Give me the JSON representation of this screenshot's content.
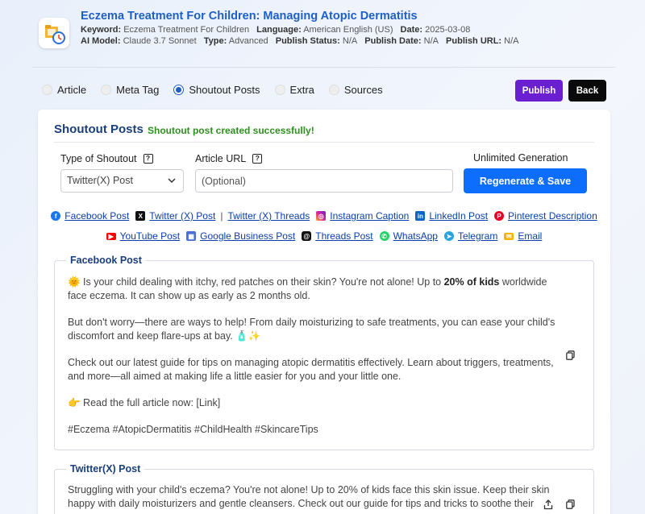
{
  "header": {
    "title": "Eczema Treatment For Children: Managing Atopic Dermatitis",
    "keyword_label": "Keyword:",
    "keyword": "Eczema Treatment For Children",
    "language_label": "Language:",
    "language": "American English (US)",
    "date_label": "Date:",
    "date": "2025-03-08",
    "model_label": "AI Model:",
    "model": "Claude 3.7 Sonnet",
    "type_label": "Type:",
    "type": "Advanced",
    "publish_status_label": "Publish Status:",
    "publish_status": "N/A",
    "publish_date_label": "Publish Date:",
    "publish_date": "N/A",
    "publish_url_label": "Publish URL:",
    "publish_url": "N/A"
  },
  "tabs": [
    {
      "label": "Article",
      "selected": false
    },
    {
      "label": "Meta Tag",
      "selected": false
    },
    {
      "label": "Shoutout Posts",
      "selected": true
    },
    {
      "label": "Extra",
      "selected": false
    },
    {
      "label": "Sources",
      "selected": false
    }
  ],
  "actions": {
    "publish": "Publish",
    "back": "Back"
  },
  "card": {
    "title": "Shoutout Posts",
    "success": "Shoutout post created successfully!",
    "type_label": "Type of Shoutout",
    "type_value": "Twitter(X) Post",
    "url_label": "Article URL",
    "url_placeholder": "(Optional)",
    "unlimited": "Unlimited Generation",
    "regen": "Regenerate & Save"
  },
  "platforms_row1": [
    {
      "label": "Facebook Post",
      "icon": "facebook-icon",
      "color": "#1877f2"
    },
    {
      "label": "Twitter (X) Post",
      "icon": "x-icon",
      "color": "#111111"
    },
    {
      "label": "Twitter (X) Threads",
      "icon": "",
      "color": ""
    },
    {
      "label": "Instagram Caption",
      "icon": "instagram-icon",
      "color": "#d6249f"
    },
    {
      "label": "LinkedIn Post",
      "icon": "linkedin-icon",
      "color": "#0a66c2"
    },
    {
      "label": "Pinterest Description",
      "icon": "pinterest-icon",
      "color": "#e60023"
    }
  ],
  "platforms_row2": [
    {
      "label": "YouTube Post",
      "icon": "youtube-icon",
      "color": "#ff0000"
    },
    {
      "label": "Google Business Post",
      "icon": "google-business-icon",
      "color": "#4a6fd8"
    },
    {
      "label": "Threads Post",
      "icon": "threads-icon",
      "color": "#111111"
    },
    {
      "label": "WhatsApp",
      "icon": "whatsapp-icon",
      "color": "#25d366"
    },
    {
      "label": "Telegram",
      "icon": "telegram-icon",
      "color": "#2aa3de"
    },
    {
      "label": "Email",
      "icon": "email-icon",
      "color": "#f4b400"
    }
  ],
  "posts": {
    "facebook": {
      "title": "Facebook Post",
      "p1_pre": "🌞 Is your child dealing with itchy, red patches on their skin? You're not alone! Up to ",
      "p1_bold": "20% of kids",
      "p1_post": " worldwide face eczema. It can show up as early as 2 months old.",
      "p2": "But don't worry—there are ways to help! From daily moisturizing to safe treatments, you can ease your child's discomfort and keep flare-ups at bay. 🧴✨",
      "p3": "Check out our latest guide for tips on managing atopic dermatitis effectively. Learn about triggers, treatments, and more—all aimed at making life a little easier for you and your little one.",
      "p4": "👉 Read the full article now: [Link]",
      "p5": "#Eczema #AtopicDermatitis #ChildHealth #SkincareTips"
    },
    "twitter": {
      "title": "Twitter(X) Post",
      "body": "Struggling with your child's eczema? You're not alone! Up to 20% of kids face this skin issue. Keep their skin happy with daily moisturizers and gentle cleansers. Check out our guide for tips and tricks to soothe their"
    }
  }
}
